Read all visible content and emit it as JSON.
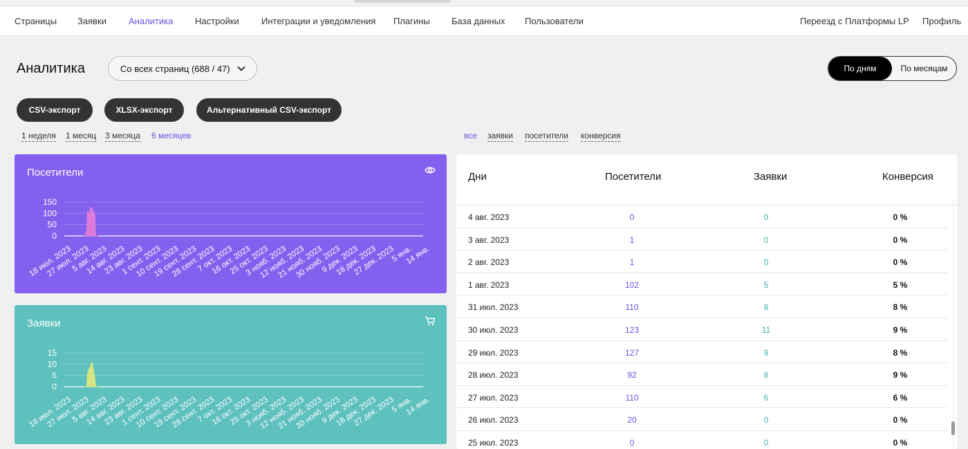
{
  "nav": {
    "items": [
      {
        "label": "Страницы",
        "active": false
      },
      {
        "label": "Заявки",
        "active": false
      },
      {
        "label": "Аналитика",
        "active": true
      },
      {
        "label": "Настройки",
        "active": false
      },
      {
        "label": "Интеграции и уведомления",
        "active": false
      },
      {
        "label": "Плагины",
        "active": false
      },
      {
        "label": "База данных",
        "active": false
      },
      {
        "label": "Пользователи",
        "active": false
      }
    ],
    "right": [
      "Переезд с Платформы LP",
      "Профиль"
    ]
  },
  "page_title": "Аналитика",
  "source_select": {
    "value": "Со всех страниц (688 / 47)",
    "icon": "chevron-down-icon"
  },
  "granularity": {
    "options": [
      "По дням",
      "По месяцам"
    ],
    "selected": "По дням"
  },
  "export_buttons": [
    "CSV-экспорт",
    "XLSX-экспорт",
    "Альтернативный CSV-экспорт"
  ],
  "periods": {
    "options": [
      "1 неделя",
      "1 месяц",
      "3 месяца",
      "6 месяцев"
    ],
    "selected": "6 месяцев"
  },
  "filters": {
    "options": [
      "все",
      "заявки",
      "посетители",
      "конверсия"
    ],
    "selected": "все"
  },
  "colors": {
    "accent": "#6b4fe0",
    "visitors_card": "#8460ee",
    "orders_card": "#5ec1be",
    "visitors_fill": "#de7ad9",
    "orders_fill": "#d6e683"
  },
  "chart_data": [
    {
      "type": "area",
      "title": "Посетители",
      "icon": "eye-icon",
      "ylim": [
        0,
        150
      ],
      "yticks": [
        0,
        50,
        100,
        150
      ],
      "x_tick_labels": [
        "18 июл. 2023",
        "27 июл. 2023",
        "5 авг. 2023",
        "14 авг. 2023",
        "23 авг. 2023",
        "1 сент. 2023",
        "10 сент. 2023",
        "19 сент. 2023",
        "28 сент. 2023",
        "7 окт. 2023",
        "16 окт. 2023",
        "25 окт. 2023",
        "3 нояб. 2023",
        "12 нояб. 2023",
        "21 нояб. 2023",
        "30 нояб. 2023",
        "9 дек. 2023",
        "18 дек. 2023",
        "27 дек. 2023",
        "5 янв.",
        "14 янв."
      ],
      "x": [
        "24 июл. 2023",
        "25 июл. 2023",
        "26 июл. 2023",
        "27 июл. 2023",
        "28 июл. 2023",
        "29 июл. 2023",
        "30 июл. 2023",
        "31 июл. 2023",
        "1 авг. 2023",
        "2 авг. 2023",
        "3 авг. 2023",
        "4 авг. 2023"
      ],
      "values": [
        0,
        0,
        20,
        110,
        92,
        127,
        123,
        110,
        102,
        1,
        1,
        0
      ],
      "grid": true
    },
    {
      "type": "area",
      "title": "Заявки",
      "icon": "cart-icon",
      "ylim": [
        0,
        15
      ],
      "yticks": [
        0,
        5,
        10,
        15
      ],
      "x_tick_labels": [
        "18 июл. 2023",
        "27 июл. 2023",
        "5 авг. 2023",
        "14 авг. 2023",
        "23 авг. 2023",
        "1 сент. 2023",
        "10 сент. 2023",
        "19 сент. 2023",
        "28 сент. 2023",
        "7 окт. 2023",
        "16 окт. 2023",
        "25 окт. 2023",
        "3 нояб. 2023",
        "12 нояб. 2023",
        "21 нояб. 2023",
        "30 нояб. 2023",
        "9 дек. 2023",
        "18 дек. 2023",
        "27 дек. 2023",
        "5 янв.",
        "14 янв."
      ],
      "x": [
        "24 июл. 2023",
        "25 июл. 2023",
        "26 июл. 2023",
        "27 июл. 2023",
        "28 июл. 2023",
        "29 июл. 2023",
        "30 июл. 2023",
        "31 июл. 2023",
        "1 авг. 2023",
        "2 авг. 2023",
        "3 авг. 2023",
        "4 авг. 2023"
      ],
      "values": [
        0,
        0,
        0,
        6,
        8,
        9,
        11,
        8,
        5,
        0,
        0,
        0
      ],
      "grid": true
    }
  ],
  "table": {
    "headers": [
      "Дни",
      "Посетители",
      "Заявки",
      "Конверсия"
    ],
    "rows": [
      {
        "day": "4 авг. 2023",
        "visitors": "0",
        "orders": "0",
        "conversion": "0 %"
      },
      {
        "day": "3 авг. 2023",
        "visitors": "1",
        "orders": "0",
        "conversion": "0 %"
      },
      {
        "day": "2 авг. 2023",
        "visitors": "1",
        "orders": "0",
        "conversion": "0 %"
      },
      {
        "day": "1 авг. 2023",
        "visitors": "102",
        "orders": "5",
        "conversion": "5 %"
      },
      {
        "day": "31 июл. 2023",
        "visitors": "110",
        "orders": "8",
        "conversion": "8 %"
      },
      {
        "day": "30 июл. 2023",
        "visitors": "123",
        "orders": "11",
        "conversion": "9 %"
      },
      {
        "day": "29 июл. 2023",
        "visitors": "127",
        "orders": "9",
        "conversion": "8 %"
      },
      {
        "day": "28 июл. 2023",
        "visitors": "92",
        "orders": "8",
        "conversion": "9 %"
      },
      {
        "day": "27 июл. 2023",
        "visitors": "110",
        "orders": "6",
        "conversion": "6 %"
      },
      {
        "day": "26 июл. 2023",
        "visitors": "20",
        "orders": "0",
        "conversion": "0 %"
      },
      {
        "day": "25 июл. 2023",
        "visitors": "0",
        "orders": "0",
        "conversion": "0 %"
      }
    ]
  }
}
